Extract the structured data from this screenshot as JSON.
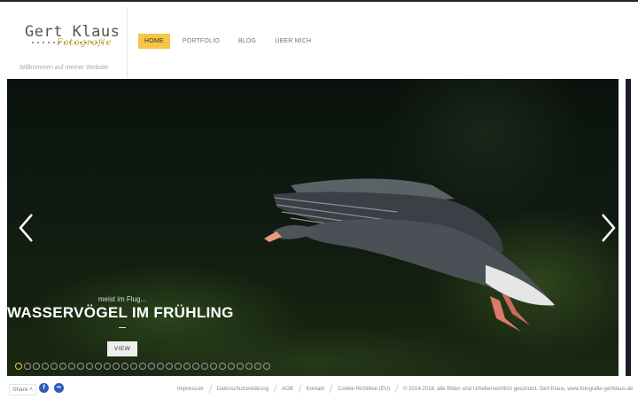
{
  "header": {
    "logo_main": "Gert Klaus",
    "logo_sub": "Fotografie",
    "tagline": "Willkommen auf meiner Website"
  },
  "nav": {
    "items": [
      {
        "label": "HOME",
        "active": true
      },
      {
        "label": "PORTFOLIO",
        "active": false
      },
      {
        "label": "BLOG",
        "active": false
      },
      {
        "label": "ÜBER MICH",
        "active": false
      }
    ]
  },
  "slider": {
    "caption_sub": "meist im Flug...",
    "caption_title": "WASSERVÖGEL IM FRÜHLING",
    "view_label": "VIEW",
    "slide_count": 29,
    "active_slide": 1
  },
  "footer": {
    "share_label": "Share",
    "social": [
      "facebook-icon",
      "flickr-icon"
    ],
    "links": [
      "Impressum",
      "Datenschutzerklärung",
      "AGB",
      "Kontakt",
      "Cookie-Richtlinie (EU)"
    ],
    "copyright": "© 2014-2018, alle Bilder sind Urheberrechtlich geschützt, Gert Klaus, www.fotografie-gertklaus.de"
  },
  "colors": {
    "accent": "#f7c548",
    "social_blue": "#2d5bb8"
  }
}
